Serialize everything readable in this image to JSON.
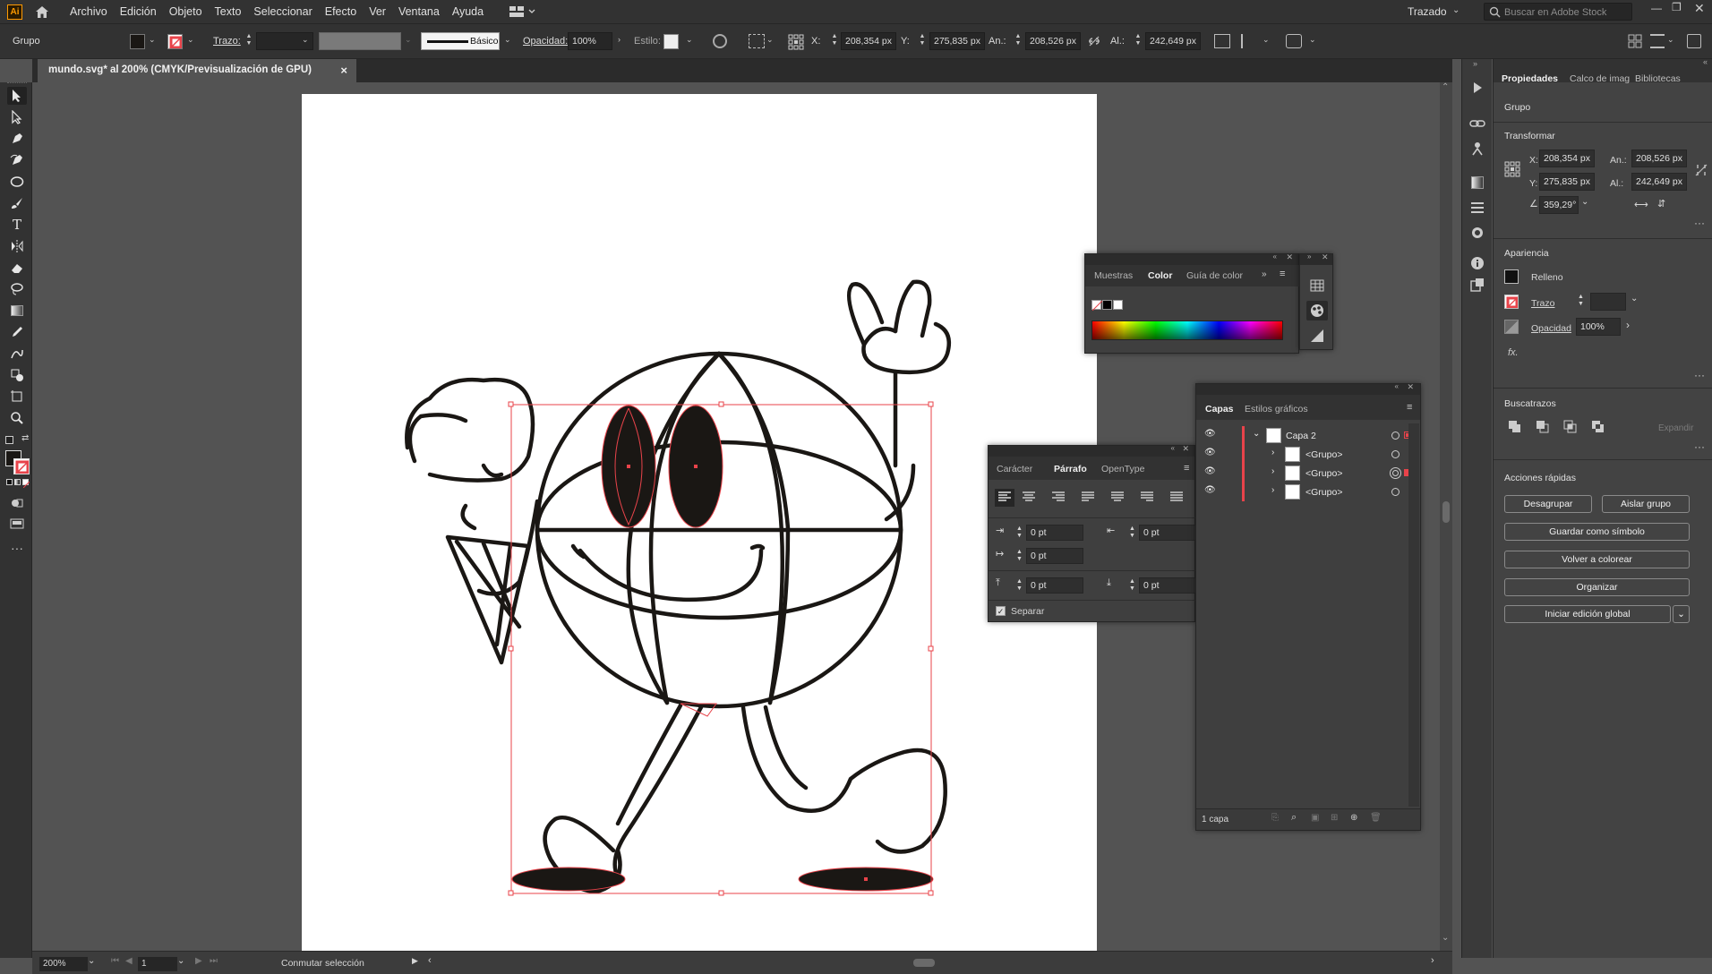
{
  "app": {
    "logo": "Ai"
  },
  "menu": [
    "Archivo",
    "Edición",
    "Objeto",
    "Texto",
    "Seleccionar",
    "Efecto",
    "Ver",
    "Ventana",
    "Ayuda"
  ],
  "workspace": {
    "label": "Trazado",
    "search_placeholder": "Buscar en Adobe Stock"
  },
  "control": {
    "selection_type": "Grupo",
    "trazo_label": "Trazo:",
    "brush_label": "Básico",
    "opacity_label": "Opacidad:",
    "opacity_value": "100%",
    "style_label": "Estilo:",
    "x_label": "X:",
    "x_value": "208,354 px",
    "y_label": "Y:",
    "y_value": "275,835 px",
    "w_label": "An.:",
    "w_value": "208,526 px",
    "h_label": "Al.:",
    "h_value": "242,649 px"
  },
  "document": {
    "tab_title": "mundo.svg* al 200% (CMYK/Previsualización de GPU)",
    "close": "×"
  },
  "status": {
    "zoom": "200%",
    "artboard": "1",
    "info": "Conmutar selección"
  },
  "properties": {
    "tabs": [
      "Propiedades",
      "Calco de imag",
      "Bibliotecas"
    ],
    "selection": "Grupo",
    "transform_title": "Transformar",
    "x_label": "X:",
    "x_value": "208,354 px",
    "y_label": "Y:",
    "y_value": "275,835 px",
    "w_label": "An.:",
    "w_value": "208,526 px",
    "h_label": "Al.:",
    "h_value": "242,649 px",
    "angle_value": "359,29°",
    "appearance_title": "Apariencia",
    "fill_label": "Relleno",
    "stroke_label": "Trazo",
    "opacity_label": "Opacidad",
    "opacity_value": "100%",
    "fx_label": "fx.",
    "pathfinder_title": "Buscatrazos",
    "expand_label": "Expandir",
    "quick_actions_title": "Acciones rápidas",
    "btn_ungroup": "Desagrupar",
    "btn_isolate": "Aislar grupo",
    "btn_save_symbol": "Guardar como símbolo",
    "btn_recolor": "Volver a colorear",
    "btn_arrange": "Organizar",
    "btn_global_edit": "Iniciar edición global"
  },
  "color_panel": {
    "tabs": [
      "Muestras",
      "Color",
      "Guía de color"
    ]
  },
  "paragraph_panel": {
    "tabs": [
      "Carácter",
      "Párrafo",
      "OpenType"
    ],
    "field_value": "0 pt",
    "hyphenate_label": "Separar"
  },
  "layers_panel": {
    "tabs": [
      "Capas",
      "Estilos gráficos"
    ],
    "layer_name": "Capa 2",
    "sublayers": [
      "<Grupo>",
      "<Grupo>",
      "<Grupo>"
    ],
    "footer": "1 capa"
  },
  "colors": {
    "accent_red": "#e8434a",
    "ui_dark": "#323232",
    "ui_mid": "#535353"
  }
}
